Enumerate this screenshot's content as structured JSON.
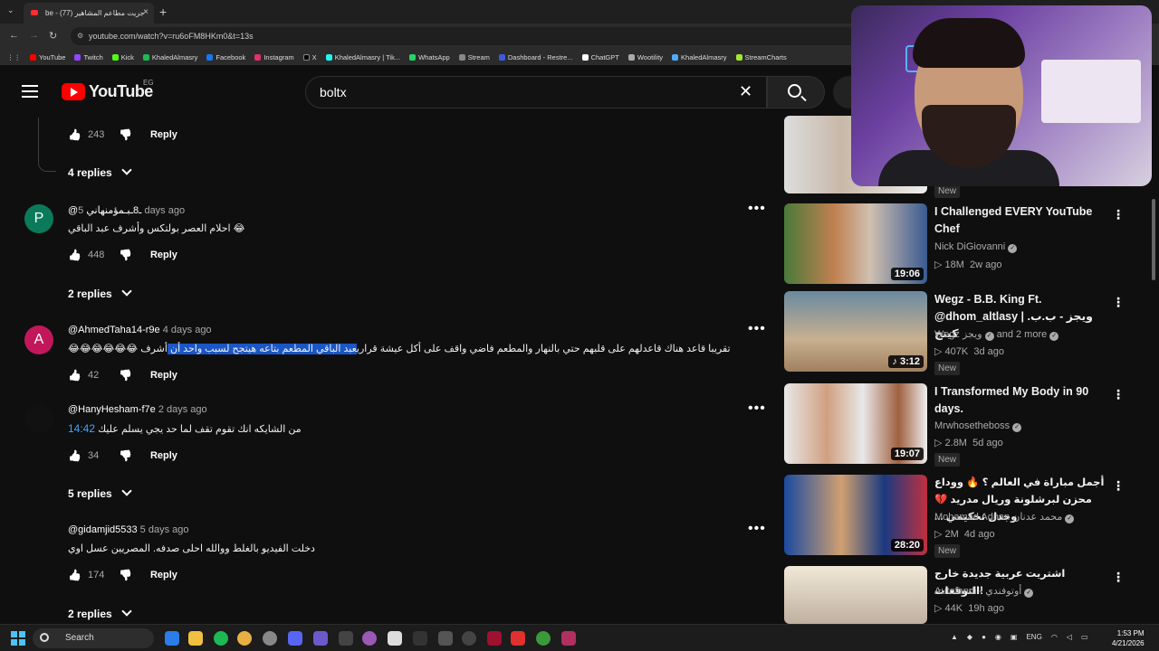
{
  "browser": {
    "tab_title": "جريت مطاعم المشاهير (77)",
    "tab_prefix": "be",
    "url": "youtube.com/watch?v=ru6oFM8HKm0&t=13s",
    "bookmarks": [
      "YouTube",
      "Twitch",
      "Kick",
      "KhaledAlmasry",
      "Facebook",
      "Instagram",
      "X",
      "KhaledAlmasry | Tik...",
      "WhatsApp",
      "Stream",
      "Dashboard - Restre...",
      "ChatGPT",
      "Wootility",
      "KhaledAlmasry",
      "StreamCharts"
    ]
  },
  "header": {
    "logo_text": "YouTube",
    "country": "EG",
    "search_value": "boltx"
  },
  "comments": [
    {
      "likes": "243",
      "reply_label": "Reply",
      "replies_label": "4 replies"
    },
    {
      "avatar_letter": "P",
      "author": "@ـ8ـبـمؤمنهاني",
      "time": "5 days ago",
      "text": "احلام العصر بولتكس وأشرف عبد الباقي 😂",
      "likes": "448",
      "reply_label": "Reply",
      "replies_label": "2 replies"
    },
    {
      "avatar_letter": "A",
      "author": "@AhmedTaha14-r9e",
      "time": "4 days ago",
      "text_plain": "😂😂😂😂😂😂 أشرف عبد الباقي المطعم بتاعه هيتجح لسبب واحد أن تقريبا قاعد هناك قاعدلهم  على قلبهم حتي بالنهار والمطعم فاضي واقف على أكل عيشة قراري",
      "text_before": "😂😂😂😂😂😂 تقريبا قاعد هناك قاعدلهم  على قلبهم حتي بالنهار والمطعم فاضي واقف على أكل عيشة قراري",
      "text_highlight": "عبد الباقي المطعم بتاعه هيتجح لسبب واحد أن ",
      "text_after": "أشرف ",
      "likes": "42",
      "reply_label": "Reply"
    },
    {
      "author": "@HanyHesham-f7e",
      "time": "2 days ago",
      "timestamp": "14:42",
      "text": "من الشايكه انك تقوم تقف لما حد يجي يسلم عليك",
      "likes": "34",
      "reply_label": "Reply",
      "replies_label": "5 replies"
    },
    {
      "author": "@gidamjid5533",
      "time": "5 days ago",
      "text": "دخلت الفيديو بالغلط ووالله احلى صدفه.  المصريين عسل اوي",
      "likes": "174",
      "reply_label": "Reply",
      "replies_label": "2 replies"
    }
  ],
  "sidebar": [
    {
      "badge": "New"
    },
    {
      "title": "I Challenged EVERY YouTube Chef",
      "channel": "Nick DiGiovanni",
      "views": "18M",
      "age": "2w ago",
      "duration": "19:06"
    },
    {
      "title": "Wegz - B.B. King Ft. @dhom_altlasy | ويجز - ب.ب. كينج",
      "channel": "Wegz ويجز",
      "channel_extra": "and 2 more",
      "views": "407K",
      "age": "3d ago",
      "duration": "3:12",
      "badge": "New"
    },
    {
      "title": "I Transformed My Body in 90 days.",
      "channel": "Mrwhosetheboss",
      "views": "2.8M",
      "age": "5d ago",
      "duration": "19:07",
      "badge": "New"
    },
    {
      "title": "أجمل مباراة في العالم ؟ 🔥 ووداع محزن لبرشلونة وريال مدريد 💔 وجدل تحكيمي ...",
      "channel": "Mohamad Adnan محمد عدنان",
      "views": "2M",
      "age": "4d ago",
      "duration": "28:20",
      "badge": "New"
    },
    {
      "title": "اشتريت عربية جديدة خارج التوقعات!",
      "channel": "Autofandi - أوتوفندي",
      "views": "44K",
      "age": "19h ago"
    }
  ],
  "taskbar": {
    "search_label": "Search",
    "lang": "ENG",
    "time": "1:53 PM",
    "date": "4/21/2026"
  },
  "colors": {
    "accent": "#ff0000",
    "link": "#3ea6ff",
    "highlight": "#1a56c5"
  }
}
